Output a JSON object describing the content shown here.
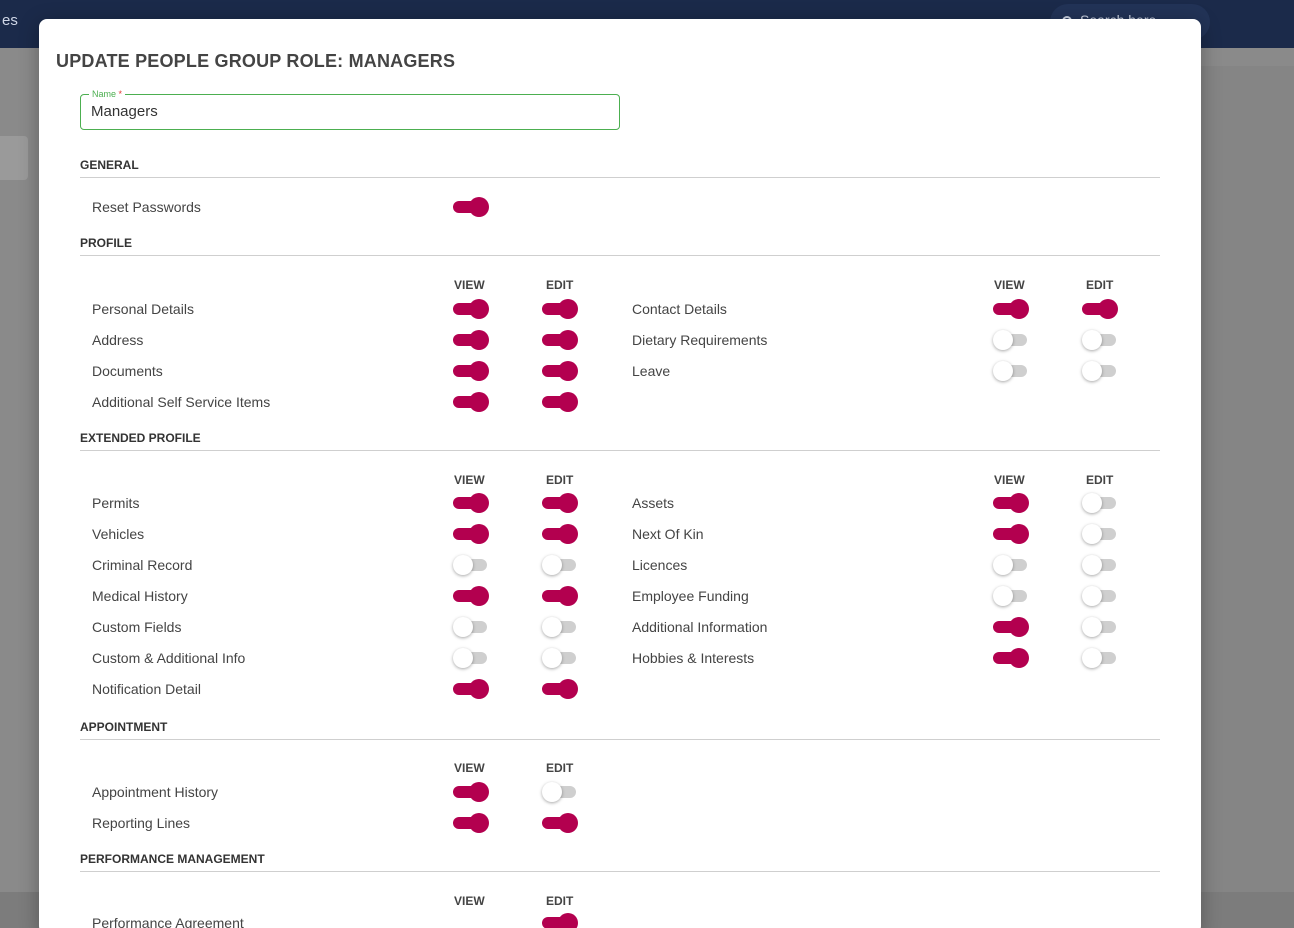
{
  "background": {
    "topbar_text": "es",
    "search_placeholder": "Search here"
  },
  "colors": {
    "accent": "#b3004f",
    "field_border": "#4caf50",
    "topbar": "#1b2a4a"
  },
  "modal": {
    "title": "UPDATE PEOPLE GROUP ROLE: MANAGERS",
    "name_field": {
      "label": "Name",
      "required_mark": "*",
      "value": "Managers"
    }
  },
  "column_labels": {
    "view": "VIEW",
    "edit": "EDIT"
  },
  "sections": {
    "general": {
      "title": "GENERAL",
      "items": [
        {
          "label": "Reset Passwords",
          "on": true
        }
      ]
    },
    "profile": {
      "title": "PROFILE",
      "left": [
        {
          "label": "Personal Details",
          "view": true,
          "edit": true
        },
        {
          "label": "Address",
          "view": true,
          "edit": true
        },
        {
          "label": "Documents",
          "view": true,
          "edit": true
        },
        {
          "label": "Additional Self Service Items",
          "view": true,
          "edit": true
        }
      ],
      "right": [
        {
          "label": "Contact Details",
          "view": true,
          "edit": true
        },
        {
          "label": "Dietary Requirements",
          "view": false,
          "edit": false
        },
        {
          "label": "Leave",
          "view": false,
          "edit": false
        }
      ]
    },
    "extended_profile": {
      "title": "EXTENDED PROFILE",
      "left": [
        {
          "label": "Permits",
          "view": true,
          "edit": true
        },
        {
          "label": "Vehicles",
          "view": true,
          "edit": true
        },
        {
          "label": "Criminal Record",
          "view": false,
          "edit": false
        },
        {
          "label": "Medical History",
          "view": true,
          "edit": true
        },
        {
          "label": "Custom Fields",
          "view": false,
          "edit": false
        },
        {
          "label": "Custom & Additional Info",
          "view": false,
          "edit": false
        },
        {
          "label": "Notification Detail",
          "view": true,
          "edit": true
        }
      ],
      "right": [
        {
          "label": "Assets",
          "view": true,
          "edit": false
        },
        {
          "label": "Next Of Kin",
          "view": true,
          "edit": false
        },
        {
          "label": "Licences",
          "view": false,
          "edit": false
        },
        {
          "label": "Employee Funding",
          "view": false,
          "edit": false
        },
        {
          "label": "Additional Information",
          "view": true,
          "edit": false
        },
        {
          "label": "Hobbies & Interests",
          "view": true,
          "edit": false
        }
      ]
    },
    "appointment": {
      "title": "APPOINTMENT",
      "left": [
        {
          "label": "Appointment History",
          "view": true,
          "edit": false
        },
        {
          "label": "Reporting Lines",
          "view": true,
          "edit": true
        }
      ]
    },
    "performance_management": {
      "title": "PERFORMANCE MANAGEMENT",
      "left": [
        {
          "label": "Performance Agreement",
          "edit": true
        }
      ]
    }
  }
}
